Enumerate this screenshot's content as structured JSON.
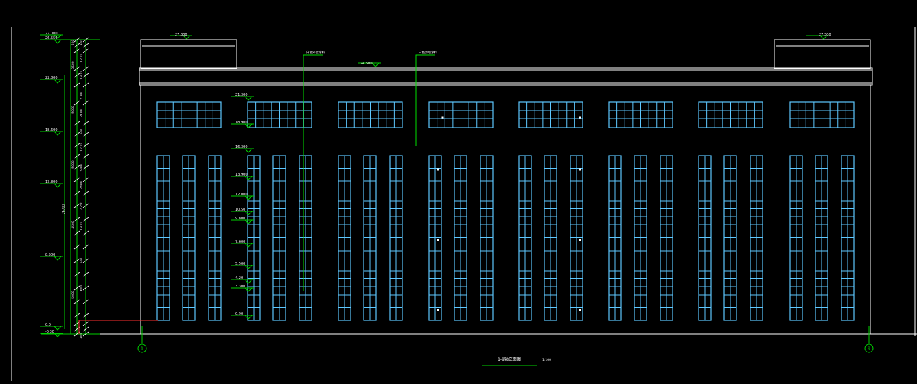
{
  "drawing": {
    "title": "1-9轴立面图",
    "scale": "1:100",
    "axis_left": "1",
    "axis_right": "9"
  },
  "left_levels": [
    "27.000",
    "26.550",
    "22.800",
    "18.600",
    "13.800",
    "8.500",
    "0.0",
    "-0.30"
  ],
  "left_dims": [
    "300",
    "300",
    "3500",
    "1200",
    "5000",
    "2100",
    "1300",
    "5000",
    "2100",
    "500",
    "4500",
    "1700",
    "2400",
    "5000",
    "2400",
    "4350",
    "1300",
    "500",
    "600",
    "300",
    "26700"
  ],
  "top_levels": {
    "left_parapet": "27.300",
    "roof": "24.500",
    "right_parapet": "27.300"
  },
  "inner_levels": [
    "21.300",
    "18.900",
    "16.300",
    "13.900",
    "12.000",
    "10.50",
    "9.800",
    "7.600",
    "5.500",
    "4.20",
    "3.300",
    "0.90"
  ],
  "notes": [
    "白色外墙涂料",
    "白色外墙涂料"
  ],
  "colors": {
    "background": "#000000",
    "line": "#ffffff",
    "window": "#5ec8ff",
    "leader": "#00e000",
    "marker": "#00d200",
    "datum": "#ff3030"
  }
}
